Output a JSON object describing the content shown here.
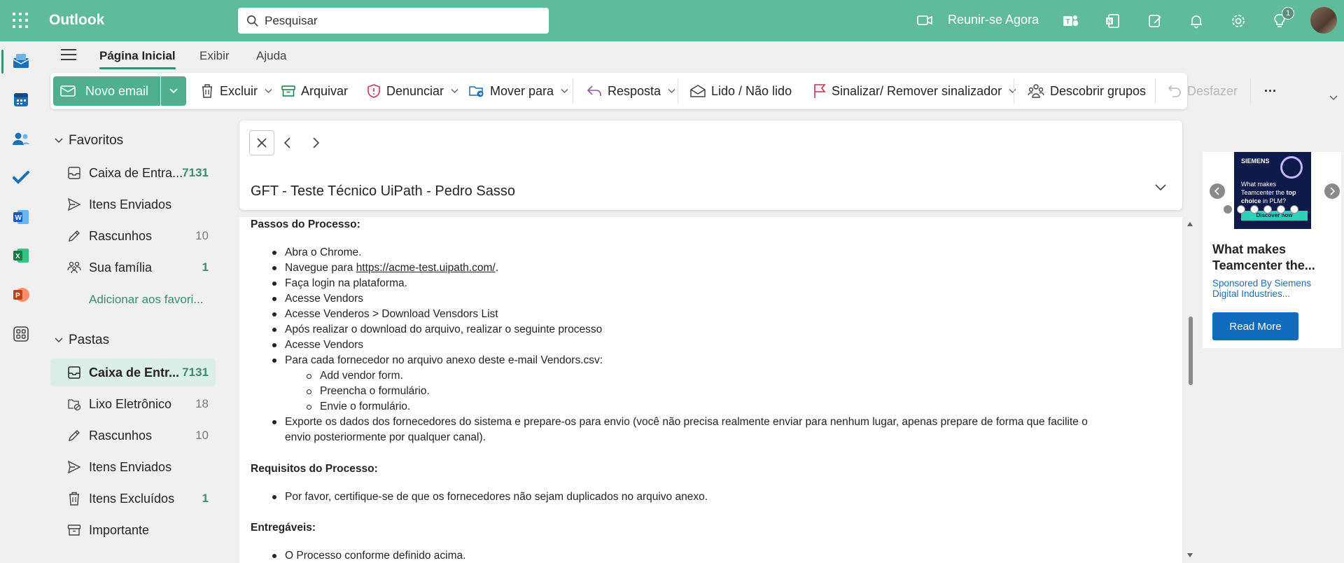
{
  "app": {
    "title": "Outlook"
  },
  "search": {
    "placeholder": "Pesquisar"
  },
  "topbar": {
    "meet_label": "Reunir-se Agora",
    "tips_badge": "1"
  },
  "ribbon": {
    "tabs": [
      {
        "label": "Página Inicial",
        "active": true
      },
      {
        "label": "Exibir",
        "active": false
      },
      {
        "label": "Ajuda",
        "active": false
      }
    ]
  },
  "toolbar": {
    "new_mail": "Novo email",
    "delete": "Excluir",
    "archive": "Arquivar",
    "report": "Denunciar",
    "move": "Mover para",
    "reply": "Resposta",
    "read_unread": "Lido / Não lido",
    "flag": "Sinalizar/ Remover sinalizador",
    "groups": "Descobrir grupos",
    "undo": "Desfazer",
    "more": "···"
  },
  "favorites": {
    "header": "Favoritos",
    "items": [
      {
        "label": "Caixa de Entra...",
        "count": "7131"
      },
      {
        "label": "Itens Enviados",
        "count": ""
      },
      {
        "label": "Rascunhos",
        "count": "10"
      },
      {
        "label": "Sua família",
        "count": "1"
      }
    ],
    "add": "Adicionar aos favori..."
  },
  "folders": {
    "header": "Pastas",
    "items": [
      {
        "label": "Caixa de Entr...",
        "count": "7131"
      },
      {
        "label": "Lixo Eletrônico",
        "count": "18"
      },
      {
        "label": "Rascunhos",
        "count": "10"
      },
      {
        "label": "Itens Enviados",
        "count": ""
      },
      {
        "label": "Itens Excluídos",
        "count": "1"
      },
      {
        "label": "Importante",
        "count": ""
      }
    ]
  },
  "message": {
    "subject": "GFT - Teste Técnico UiPath - Pedro Sasso",
    "steps_heading": "Passos do Processo:",
    "steps": [
      "Abra o Chrome.",
      "Navegue para ",
      "Faça login na plataforma.",
      "Acesse Vendors",
      "Acesse Venderos > Download Vensdors List",
      "Após realizar o download do arquivo, realizar o seguinte processo",
      "Acesse Vendors",
      "Para cada fornecedor no arquivo anexo deste e-mail Vendors.csv:"
    ],
    "link": "https://acme-test.uipath.com/",
    "link_suffix": ".",
    "substeps": [
      "Add vendor form.",
      "Preencha o formulário.",
      "Envie o formulário."
    ],
    "export_line1": "Exporte os dados dos fornecedores do sistema e prepare-os para envio (você não precisa realmente enviar para nenhum lugar, apenas prepare de forma que facilite o",
    "export_line2": "envio posteriormente por qualquer canal).",
    "req_heading": "Requisitos do Processo:",
    "req_item": "Por favor, certifique-se de que os fornecedores não sejam duplicados no arquivo anexo.",
    "deliv_heading": "Entregáveis:",
    "deliv_item": "O Processo conforme definido acima."
  },
  "ad": {
    "brand": "SIEMENS",
    "image_text_pre": "What makes Teamcenter the ",
    "image_text_bold": "top choice",
    "image_text_post": " in PLM?",
    "image_cta": "Discover now",
    "title": "What makes Teamcenter the...",
    "sponsor": "Sponsored By Siemens Digital Industries...",
    "button": "Read More"
  },
  "colors": {
    "brand": "#5fbb9c",
    "new_mail": "#4fb08f",
    "accent": "#3f8a72",
    "ad_button": "#0f6cbd"
  }
}
